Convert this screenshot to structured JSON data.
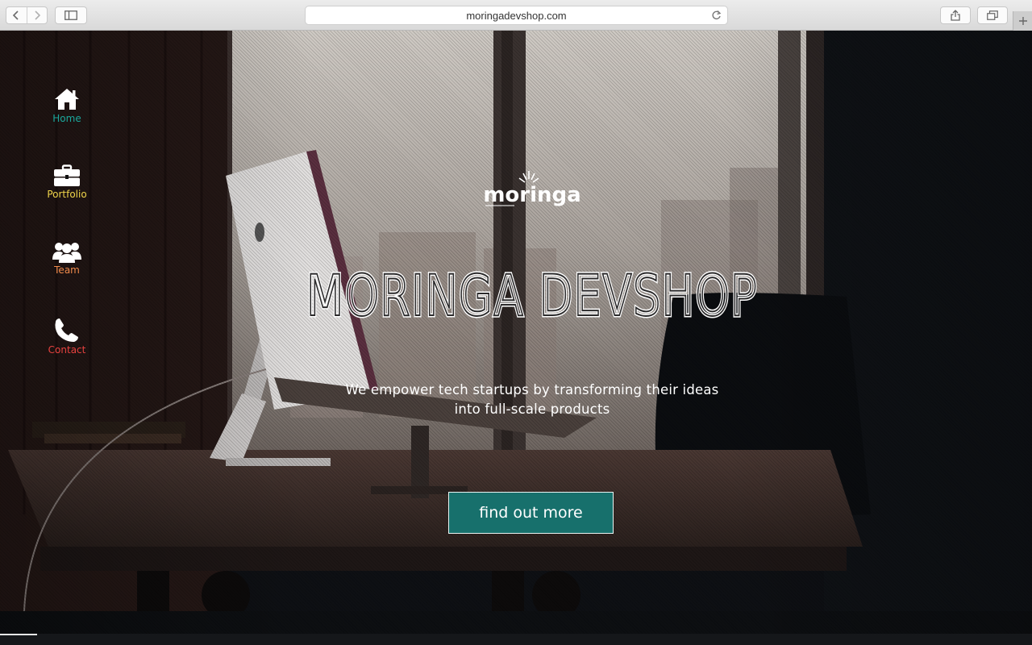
{
  "browser": {
    "url": "moringadevshop.com",
    "icons": {
      "back": "chevron-left-icon",
      "forward": "chevron-right-icon",
      "sidebar": "sidebar-icon",
      "reload": "reload-icon",
      "share": "share-icon",
      "tabs": "tabs-icon",
      "new_tab": "plus-icon"
    }
  },
  "sidenav": {
    "items": [
      {
        "label": "Home",
        "icon": "home-icon",
        "color": "#1aa79c"
      },
      {
        "label": "Portfolio",
        "icon": "briefcase-icon",
        "color": "#f0d54b"
      },
      {
        "label": "Team",
        "icon": "users-icon",
        "color": "#f08a4b"
      },
      {
        "label": "Contact",
        "icon": "phone-icon",
        "color": "#e8423f"
      }
    ]
  },
  "hero": {
    "logo_text": "moringa",
    "title": "MORINGA DEVSHOP",
    "tagline_line1": "We empower tech startups by transforming their ideas",
    "tagline_line2": "into full-scale products",
    "cta_label": "find out more",
    "cta_color": "#17706c"
  }
}
